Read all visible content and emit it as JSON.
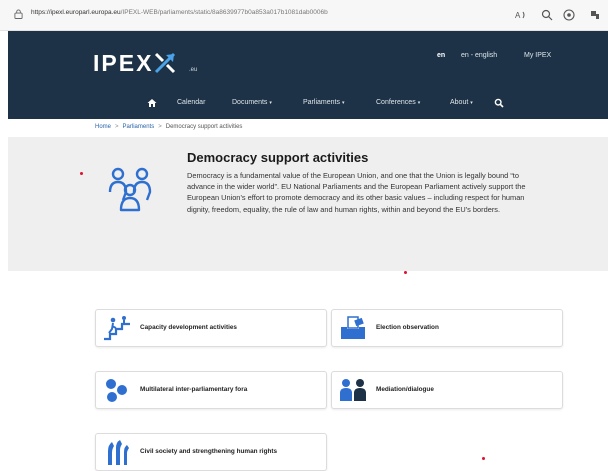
{
  "browser": {
    "url_host": "https://ipexl.europarl.europa.eu",
    "url_path": "/IPEXL-WEB/parliaments/static/8a8639977b0a853a017b1081dab0006b"
  },
  "header": {
    "logo_text": "IPEX",
    "logo_suffix": ".eu",
    "lang_code": "en",
    "lang_name": "en - english",
    "my_ipex": "My IPEX",
    "bg_color": "#1d3246"
  },
  "nav": {
    "items": [
      {
        "label": "Calendar",
        "caret": ""
      },
      {
        "label": "Documents",
        "caret": "▾"
      },
      {
        "label": "Parliaments",
        "caret": "▾"
      },
      {
        "label": "Conferences",
        "caret": "▾"
      },
      {
        "label": "About",
        "caret": "▾"
      }
    ]
  },
  "breadcrumb": {
    "items": [
      "Home",
      "Parliaments",
      "Democracy support activities"
    ],
    "separator": ">"
  },
  "intro": {
    "title": "Democracy support activities",
    "text": "Democracy is a fundamental value of the European Union, and one that the Union is legally bound “to advance in the wider world”. EU National Parliaments and the European Parliament actively support the European Union’s effort to promote democracy and its other basic values – including respect for human dignity, freedom, equality, the rule of law and human rights, within and beyond the EU’s borders.",
    "icon": "people-group-icon",
    "accent": "#2f6fd0"
  },
  "cards": [
    {
      "label": "Capacity development activities",
      "icon": "stairs-climb-icon"
    },
    {
      "label": "Election observation",
      "icon": "ballot-box-icon"
    },
    {
      "label": "Multilateral inter-parliamentary fora",
      "icon": "network-circles-icon"
    },
    {
      "label": "Mediation/dialogue",
      "icon": "dialogue-people-icon"
    },
    {
      "label": "Civil society and strengthening human rights",
      "icon": "hands-raised-icon"
    }
  ]
}
